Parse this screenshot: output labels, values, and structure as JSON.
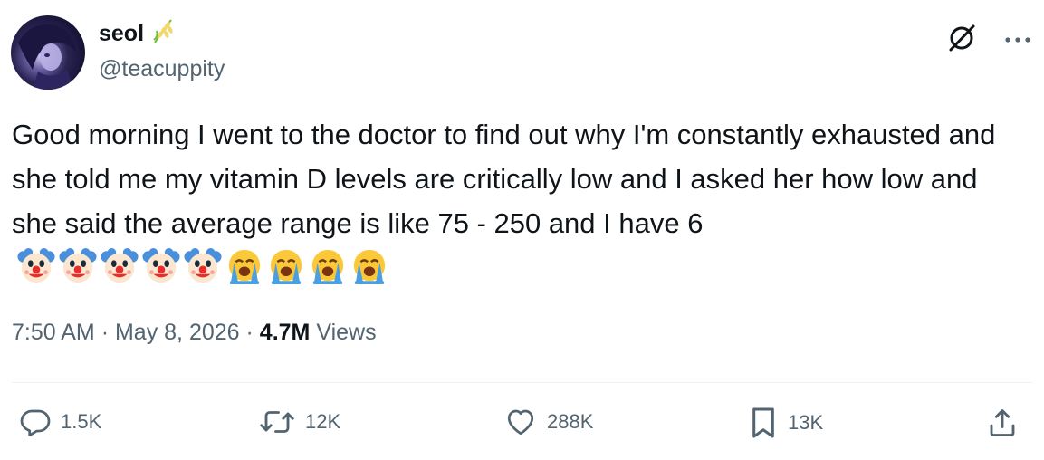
{
  "user": {
    "display_name": "seol",
    "handle": "@teacuppity",
    "name_emoji": "rice-ear-emoji"
  },
  "top_icons": [
    "grok-icon",
    "more-icon"
  ],
  "tweet": {
    "text": "Good morning I went to the doctor to find out why I'm constantly exhausted and she told me my vitamin D levels are critically low and I asked her how low and she said the average range is like 75 - 250 and I have 6",
    "emojis": [
      "clown-face",
      "clown-face",
      "clown-face",
      "clown-face",
      "clown-face",
      "loudly-crying-face",
      "loudly-crying-face",
      "loudly-crying-face",
      "loudly-crying-face"
    ]
  },
  "meta": {
    "time": "7:50 AM",
    "separator": "·",
    "date": "May 8, 2026",
    "views_count": "4.7M",
    "views_label": "Views"
  },
  "actions": {
    "replies": "1.5K",
    "reposts": "12K",
    "likes": "288K",
    "bookmarks": "13K"
  },
  "colors": {
    "text": "#0f1419",
    "secondary": "#536471",
    "divider": "#eff3f4"
  }
}
